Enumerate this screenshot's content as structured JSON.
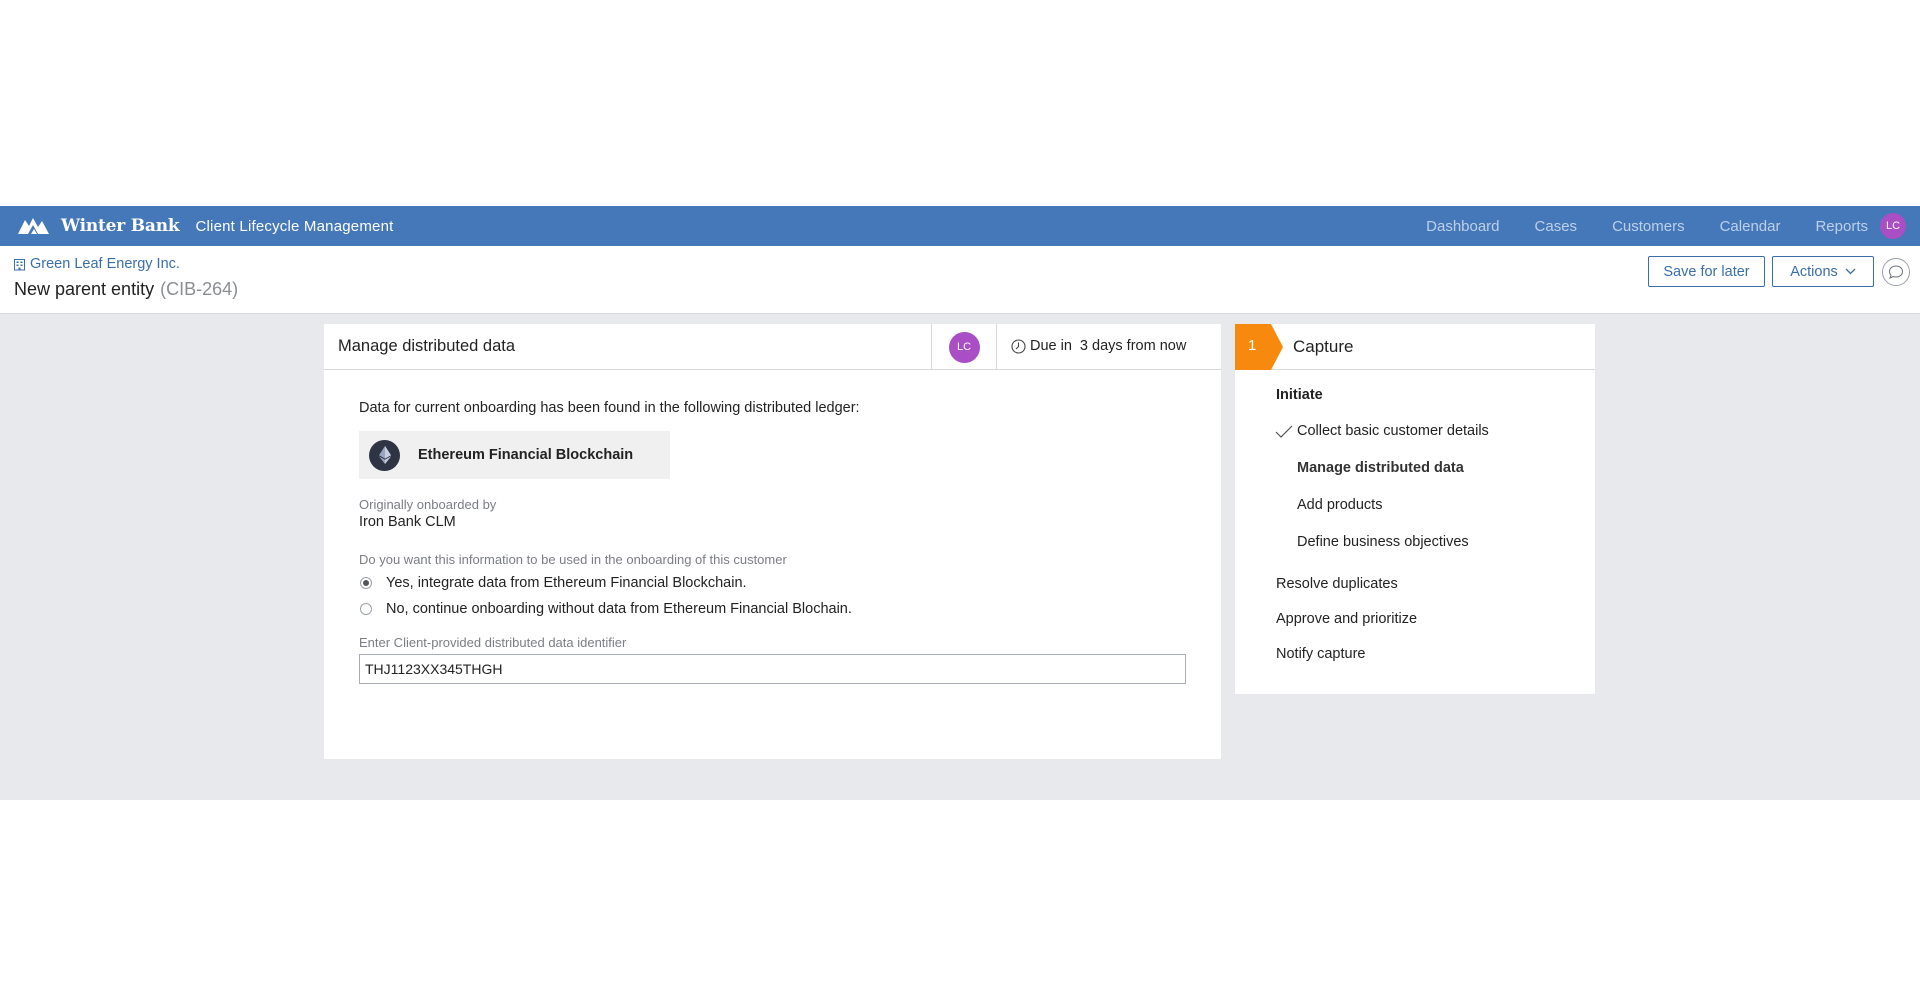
{
  "topbar": {
    "brand": "Winter Bank",
    "app_title": "Client Lifecycle Management",
    "nav": [
      "Dashboard",
      "Cases",
      "Customers",
      "Calendar",
      "Reports"
    ],
    "user_initials": "LC"
  },
  "header": {
    "breadcrumb": "Green Leaf Energy Inc.",
    "entity_title": "New parent entity",
    "case_id": "(CIB-264)",
    "save_label": "Save for later",
    "actions_label": "Actions"
  },
  "card": {
    "title": "Manage distributed data",
    "assignee_initials": "LC",
    "due_label": "Due in",
    "due_value": "3 days from now",
    "intro": "Data for current onboarding has been found in the following distributed ledger:",
    "ledger_name": "Ethereum Financial Blockchain",
    "onboarded_label": "Originally onboarded by",
    "onboarded_value": "Iron Bank CLM",
    "question": "Do you want this information to be used in the onboarding of this customer",
    "options": [
      {
        "label": "Yes, integrate data from Ethereum Financial Blockchain.",
        "selected": true
      },
      {
        "label": "No, continue onboarding without data from Ethereum Financial Blochain.",
        "selected": false
      }
    ],
    "identifier_label": "Enter Client-provided distributed data identifier",
    "identifier_value": "THJ1123XX345THGH"
  },
  "stages": {
    "stage_number": "1",
    "stage_title": "Capture",
    "group": "Initiate",
    "steps": [
      {
        "label": "Collect basic customer details",
        "status": "done"
      },
      {
        "label": "Manage distributed data",
        "status": "current"
      },
      {
        "label": "Add products",
        "status": "pending"
      },
      {
        "label": "Define business objectives",
        "status": "pending"
      }
    ],
    "other_steps": [
      "Resolve duplicates",
      "Approve and prioritize",
      "Notify capture"
    ]
  },
  "colors": {
    "topbar": "#4578b8",
    "accent_link": "#3a6ea8",
    "avatar": "#a94ec4",
    "stage": "#f78a0e",
    "background": "#e8e9ec"
  }
}
